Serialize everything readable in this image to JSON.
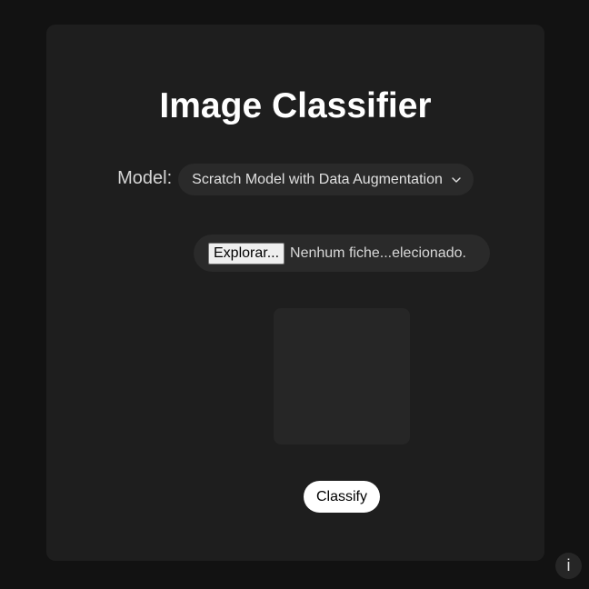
{
  "app": {
    "title": "Image Classifier"
  },
  "model": {
    "label": "Model:",
    "selected": "Scratch Model with Data Augmentation",
    "chevron_icon": "chevron-down-icon"
  },
  "file_input": {
    "button_label": "Explorar...",
    "status_text": "Nenhum fiche...elecionado."
  },
  "actions": {
    "classify_label": "Classify",
    "info_label": "i"
  },
  "colors": {
    "page_background": "#121212",
    "card_background": "#1e1e1e",
    "control_background": "#2a2a2a",
    "preview_background": "#262626",
    "primary_button": "#ffffff",
    "text": "#ffffff"
  }
}
